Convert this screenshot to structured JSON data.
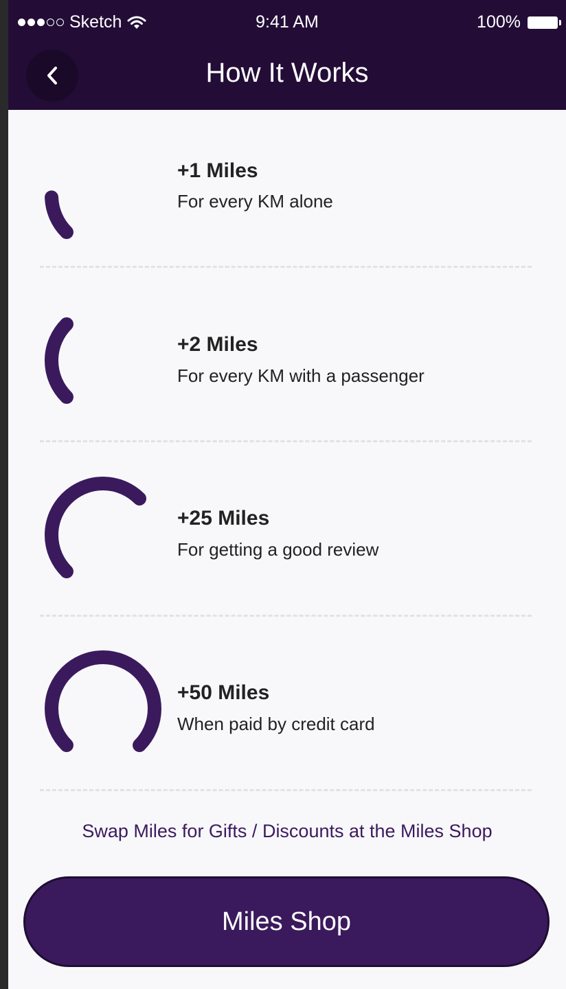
{
  "status_bar": {
    "carrier": "Sketch",
    "time": "9:41 AM",
    "battery": "100%"
  },
  "nav": {
    "title": "How It Works",
    "back_icon": "chevron-left-icon"
  },
  "rewards": [
    {
      "title": "+1 Miles",
      "description": "For every KM alone",
      "arc_fraction": 0.12
    },
    {
      "title": "+2 Miles",
      "description": "For every KM with a passenger",
      "arc_fraction": 0.25
    },
    {
      "title": "+25 Miles",
      "description": "For getting a good review",
      "arc_fraction": 0.5
    },
    {
      "title": "+50 Miles",
      "description": "When paid by credit card",
      "arc_fraction": 0.75
    }
  ],
  "promo_text": "Swap Miles for Gifts / Discounts at the Miles Shop",
  "shop_button_label": "Miles Shop",
  "colors": {
    "header_bg": "#230d36",
    "accent": "#3a1a5c",
    "background": "#f8f8fa"
  }
}
